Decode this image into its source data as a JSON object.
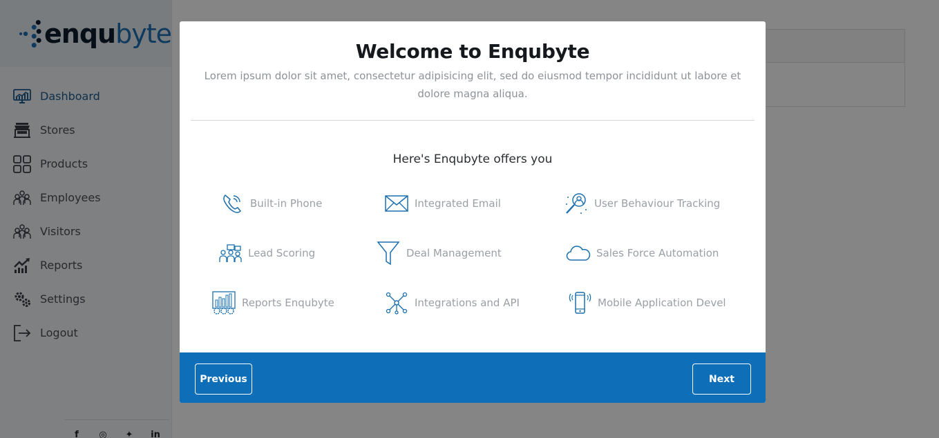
{
  "brand": {
    "logo_part1": "enqu",
    "logo_part2": "byte"
  },
  "sidebar": {
    "items": [
      {
        "label": "Dashboard",
        "icon": "dashboard-monitor-icon",
        "active": true
      },
      {
        "label": "Stores",
        "icon": "store-icon",
        "active": false
      },
      {
        "label": "Products",
        "icon": "grid-icon",
        "active": false
      },
      {
        "label": "Employees",
        "icon": "group-icon",
        "active": false
      },
      {
        "label": "Visitors",
        "icon": "group-icon",
        "active": false
      },
      {
        "label": "Reports",
        "icon": "chart-up-icon",
        "active": false
      },
      {
        "label": "Settings",
        "icon": "gears-icon",
        "active": false
      },
      {
        "label": "Logout",
        "icon": "logout-icon",
        "active": false
      }
    ],
    "social": [
      "facebook-icon",
      "instagram-icon",
      "twitter-icon",
      "linkedin-icon"
    ]
  },
  "modal": {
    "title": "Welcome to Enqubyte",
    "description": "Lorem ipsum dolor sit amet, consectetur adipisicing elit, sed do eiusmod tempor incididunt ut labore et dolore magna aliqua.",
    "offers_title": "Here's Enqubyte offers you",
    "features": [
      {
        "label": "Built-in Phone",
        "icon": "phone-icon"
      },
      {
        "label": "Integrated Email",
        "icon": "envelope-icon"
      },
      {
        "label": "User Behaviour Tracking",
        "icon": "magnifier-user-icon"
      },
      {
        "label": "Lead Scoring",
        "icon": "people-board-icon"
      },
      {
        "label": "Deal Management",
        "icon": "funnel-icon"
      },
      {
        "label": "Sales Force Automation",
        "icon": "cloud-icon"
      },
      {
        "label": "Reports Enqubyte",
        "icon": "report-gears-icon"
      },
      {
        "label": "Integrations and API",
        "icon": "network-nodes-icon"
      },
      {
        "label": "Mobile Application Devel",
        "icon": "mobile-phone-icon"
      }
    ],
    "prev_label": "Previous",
    "next_label": "Next"
  },
  "colors": {
    "accent": "#0e6fb8",
    "logo_blue": "#1e6fb2",
    "overlay": "rgba(0,0,0,0.48)"
  }
}
